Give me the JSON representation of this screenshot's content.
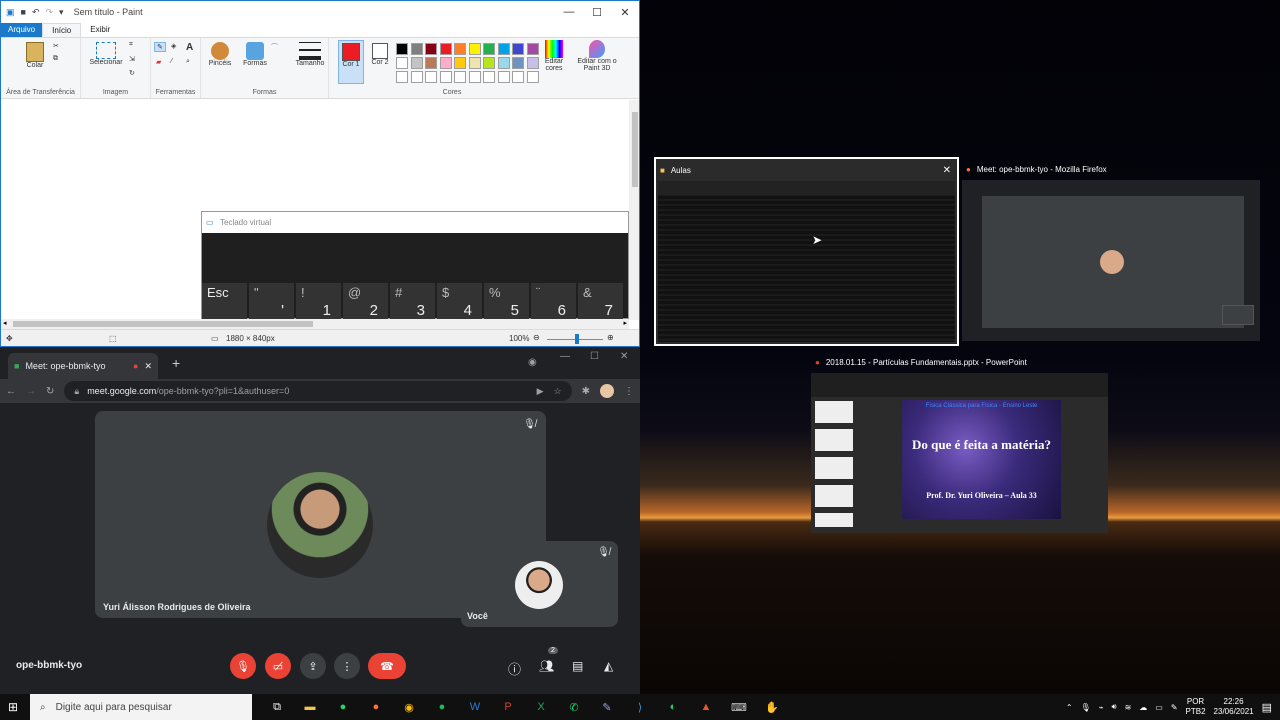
{
  "paint": {
    "title": "Sem título - Paint",
    "menu": {
      "file": "Arquivo",
      "home": "Início",
      "view": "Exibir"
    },
    "groups": {
      "clipboard": "Área de Transferência",
      "image": "Imagem",
      "tools": "Ferramentas",
      "shapes": "Formas",
      "colors": "Cores"
    },
    "buttons": {
      "paste": "Colar",
      "select": "Selecionar",
      "brushes": "Pincéis",
      "shapes": "Formas",
      "size": "Tamanho",
      "color1": "Cor 1",
      "color2": "Cor 2",
      "edit_colors": "Editar cores",
      "paint3d": "Editar com o Paint 3D"
    },
    "palette": [
      "#000000",
      "#7f7f7f",
      "#880015",
      "#ed1c24",
      "#ff7f27",
      "#fff200",
      "#22b14c",
      "#00a2e8",
      "#3f48cc",
      "#a349a4",
      "#ffffff",
      "#c3c3c3",
      "#b97a57",
      "#ffaec9",
      "#ffc90e",
      "#efe4b0",
      "#b5e61d",
      "#99d9ea",
      "#7092be",
      "#c8bfe7"
    ],
    "color1": "#ed1c24",
    "color2": "#ffffff",
    "status": {
      "dims": "1880 × 840px",
      "zoom": "100%"
    }
  },
  "keyboard": {
    "title": "Teclado virtual",
    "keys": [
      {
        "top": "",
        "main": "Esc"
      },
      {
        "top": "\"",
        "main": "'"
      },
      {
        "top": "!",
        "main": "1"
      },
      {
        "top": "@",
        "main": "2"
      },
      {
        "top": "#",
        "main": "3"
      },
      {
        "top": "$",
        "main": "4"
      },
      {
        "top": "%",
        "main": "5"
      },
      {
        "top": "¨",
        "main": "6"
      },
      {
        "top": "&",
        "main": "7"
      }
    ]
  },
  "meet": {
    "tab_title": "Meet: ope-bbmk-tyo",
    "url_host": "meet.google.com",
    "url_path": "/ope-bbmk-tyo?pli=1&authuser=0",
    "main_name": "Yuri Álisson Rodrigues de Oliveira",
    "self_name": "Você",
    "meeting_code": "ope-bbmk-tyo",
    "people_count": "2"
  },
  "taskview": {
    "explorer": "Aulas",
    "firefox": "Meet: ope-bbmk-tyo - Mozilla Firefox",
    "powerpoint": "2018.01.15 - Partículas Fundamentais.pptx - PowerPoint",
    "slide": {
      "header": "Física Clássica para Física - Ensino Leste",
      "title": "Do que é feita a matéria?",
      "subtitle": "Prof. Dr. Yuri Oliveira – Aula 33"
    }
  },
  "taskbar": {
    "search_placeholder": "Digite aqui para pesquisar",
    "lang1": "POR",
    "lang2": "PTB2",
    "time": "22:26",
    "date": "23/06/2021"
  }
}
